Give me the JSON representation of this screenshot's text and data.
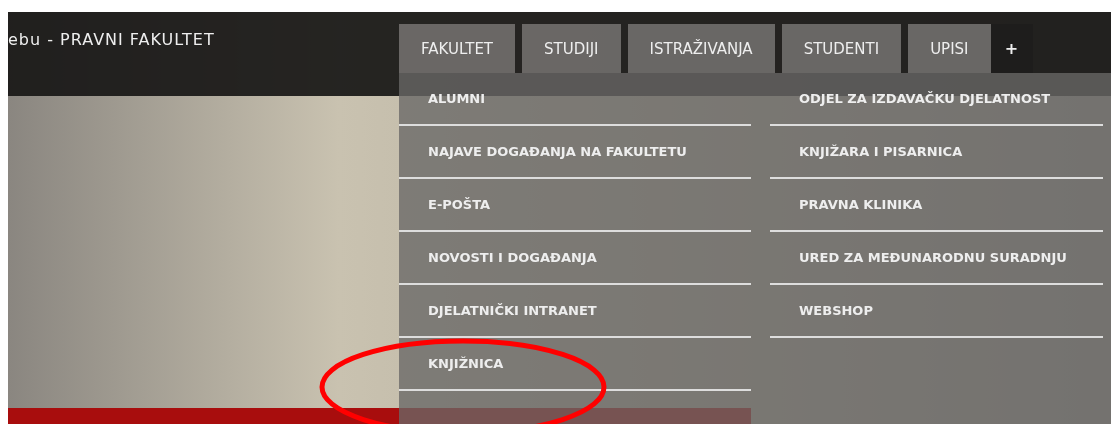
{
  "header": {
    "title": "ebu - PRAVNI FAKULTET"
  },
  "tabs": [
    {
      "label": "FAKULTET"
    },
    {
      "label": "STUDIJI"
    },
    {
      "label": "ISTRAŽIVANJA"
    },
    {
      "label": "STUDENTI"
    },
    {
      "label": "UPISI"
    }
  ],
  "more_button": "+",
  "dropdown": {
    "columns": [
      [
        "ALUMNI",
        "NAJAVE DOGAĐANJA NA FAKULTETU",
        "E-POŠTA",
        "NOVOSTI I DOGAĐANJA",
        "DJELATNIČKI INTRANET",
        "KNJIŽNICA"
      ],
      [
        "ODJEL ZA IZDAVAČKU DJELATNOST",
        "KNJIŽARA I PISARNICA",
        "PRAVNA KLINIKA",
        "URED ZA MEĐUNARODNU SURADNJU",
        "WEBSHOP"
      ]
    ]
  }
}
